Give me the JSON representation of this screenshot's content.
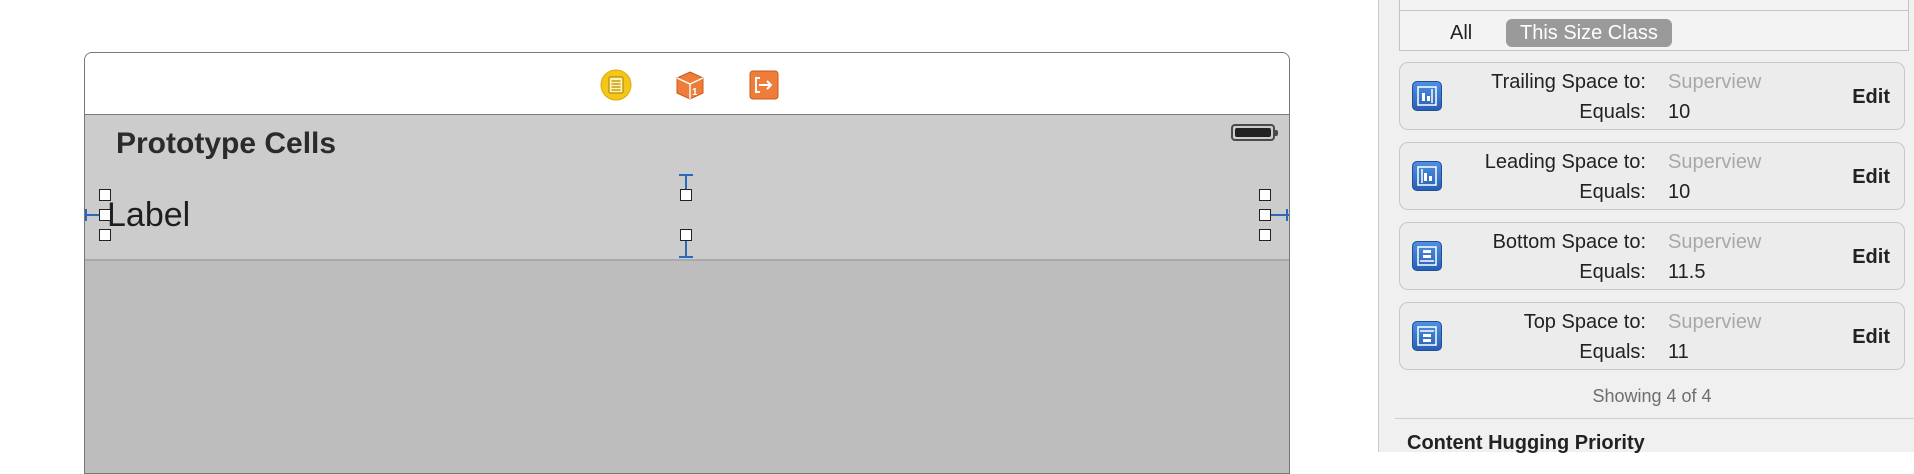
{
  "scene": {
    "header_title": "Prototype Cells",
    "cell_label": "Label",
    "dock_icons": [
      "view-controller-icon",
      "first-responder-icon",
      "exit-icon"
    ],
    "colors": {
      "dock_yellow": "#f5c61a",
      "dock_orange": "#ef7d3a",
      "constraint_blue": "#2b6ab8"
    }
  },
  "inspector": {
    "scope": {
      "all_label": "All",
      "this_size_class_label": "This Size Class"
    },
    "constraints": [
      {
        "name": "Trailing Space to:",
        "target": "Superview",
        "equals_label": "Equals:",
        "value": "10",
        "edit_label": "Edit",
        "icon": "trailing-space-icon"
      },
      {
        "name": "Leading Space to:",
        "target": "Superview",
        "equals_label": "Equals:",
        "value": "10",
        "edit_label": "Edit",
        "icon": "leading-space-icon"
      },
      {
        "name": "Bottom Space to:",
        "target": "Superview",
        "equals_label": "Equals:",
        "value": "11.5",
        "edit_label": "Edit",
        "icon": "bottom-space-icon"
      },
      {
        "name": "Top Space to:",
        "target": "Superview",
        "equals_label": "Equals:",
        "value": "11",
        "edit_label": "Edit",
        "icon": "top-space-icon"
      }
    ],
    "showing_text": "Showing 4 of 4",
    "section_title": "Content Hugging Priority",
    "colors": {
      "icon_blue": "#3a77cc",
      "scope_selected": "#9a9a9a"
    }
  }
}
